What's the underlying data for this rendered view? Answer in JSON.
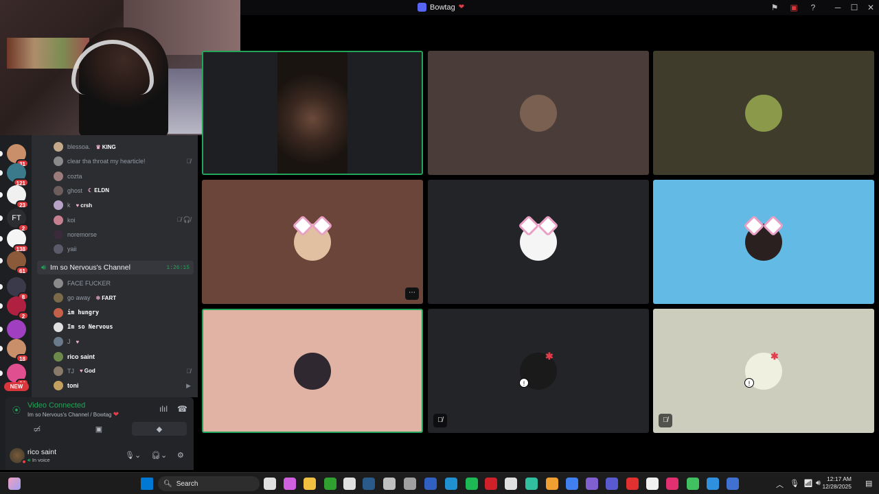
{
  "window": {
    "title": "Bowtag",
    "title_suffix": "❤"
  },
  "members": [
    {
      "name": "blessoa.",
      "tag": "KING",
      "tag_icon": "crown-icon",
      "color": "#c4a88a"
    },
    {
      "name": "clear tha throat my hearticle!",
      "color": "#8a8a8a",
      "icon": "mic-muted-icon"
    },
    {
      "name": "cozta",
      "color": "#9b7b7b"
    },
    {
      "name": "ghost",
      "tag": "ELDN",
      "tag_icon": "moon-icon",
      "color": "#6e5d5d"
    },
    {
      "name": "k",
      "tag": "crsh",
      "tag_icon": "heart-icon",
      "color": "#b8a2c8"
    },
    {
      "name": "koi",
      "color": "#c57f8f",
      "icon": "mic-muted-deafened-icon"
    },
    {
      "name": "noremorse",
      "color": "#3a2a3a"
    },
    {
      "name": "yaii",
      "color": "#5a5a6a"
    }
  ],
  "voice_channel": {
    "name": "Im so Nervous's Channel",
    "timer": "1:26:15"
  },
  "channel_members": [
    {
      "name": "FACE FUCKER",
      "color": "#8a8a8a"
    },
    {
      "name": "go away",
      "tag": "FART",
      "tag_icon": "gear-icon",
      "color": "#7b6a4a"
    },
    {
      "name": "im hungry",
      "color": "#c4604a",
      "bold": true
    },
    {
      "name": "Im so Nervous",
      "color": "#e0e0e0",
      "bold": true
    },
    {
      "name": "J",
      "tag": "",
      "tag_icon": "heart-icon",
      "color": "#6a7a8a"
    },
    {
      "name": "rico saint",
      "color": "#6b8a4a",
      "white": true
    },
    {
      "name": "TJ",
      "tag": "God",
      "tag_icon": "heart-icon",
      "color": "#8a7a6a",
      "icon": "mic-muted-icon"
    },
    {
      "name": "toni",
      "color": "#c4a060",
      "white": true,
      "icon": "video-icon"
    }
  ],
  "servers": [
    {
      "badge": "31",
      "color": "#c98e6a"
    },
    {
      "badge": "121",
      "color": "#3a7a8a"
    },
    {
      "badge": "23",
      "color": "#f0f0f0"
    },
    {
      "label": "FT",
      "badge": "2",
      "color": "#2b2d31"
    },
    {
      "badge": "138",
      "color": "#f5f5f5"
    },
    {
      "badge": "61",
      "color": "#8a5a3a"
    },
    {
      "badge": "8",
      "color": "#3a3a4a"
    },
    {
      "badge": "2",
      "color": "#b02040"
    },
    {
      "badge": "",
      "color": "#a040c0"
    },
    {
      "badge": "18",
      "color": "#c98e6a"
    },
    {
      "badge": "24",
      "color": "#e05090"
    }
  ],
  "new_label": "NEW",
  "voice_panel": {
    "status": "Video Connected",
    "location": "Im so Nervous's Channel / Bowtag",
    "location_suffix": "❤"
  },
  "user": {
    "name": "rico saint",
    "status": "In voice"
  },
  "taskbar": {
    "search_placeholder": "Search",
    "time": "12:17 AM",
    "date": "12/28/2025"
  },
  "tiles": [
    {
      "color": "#1e1f22",
      "speaking": true,
      "content": "video"
    },
    {
      "color": "#4a3c38",
      "avatar": "#7a6050"
    },
    {
      "color": "#3f3c2c",
      "avatar": "#8a9a4a"
    },
    {
      "color": "#6b443a",
      "avatar": "#e0c0a0",
      "ears": true,
      "more": true
    },
    {
      "color": "#232428",
      "avatar": "#f5f5f5",
      "ears": true
    },
    {
      "color": "#63bae5",
      "avatar": "#2a2020",
      "ears": true
    },
    {
      "color": "#e0b3a4",
      "avatar": "#302830",
      "speaking": true
    },
    {
      "color": "#232428",
      "avatar": "#1a1a1a",
      "muted": true,
      "angry": true
    },
    {
      "color": "#cdcdbd",
      "avatar": "#f0f0e0",
      "muted": true,
      "angry": true
    }
  ]
}
